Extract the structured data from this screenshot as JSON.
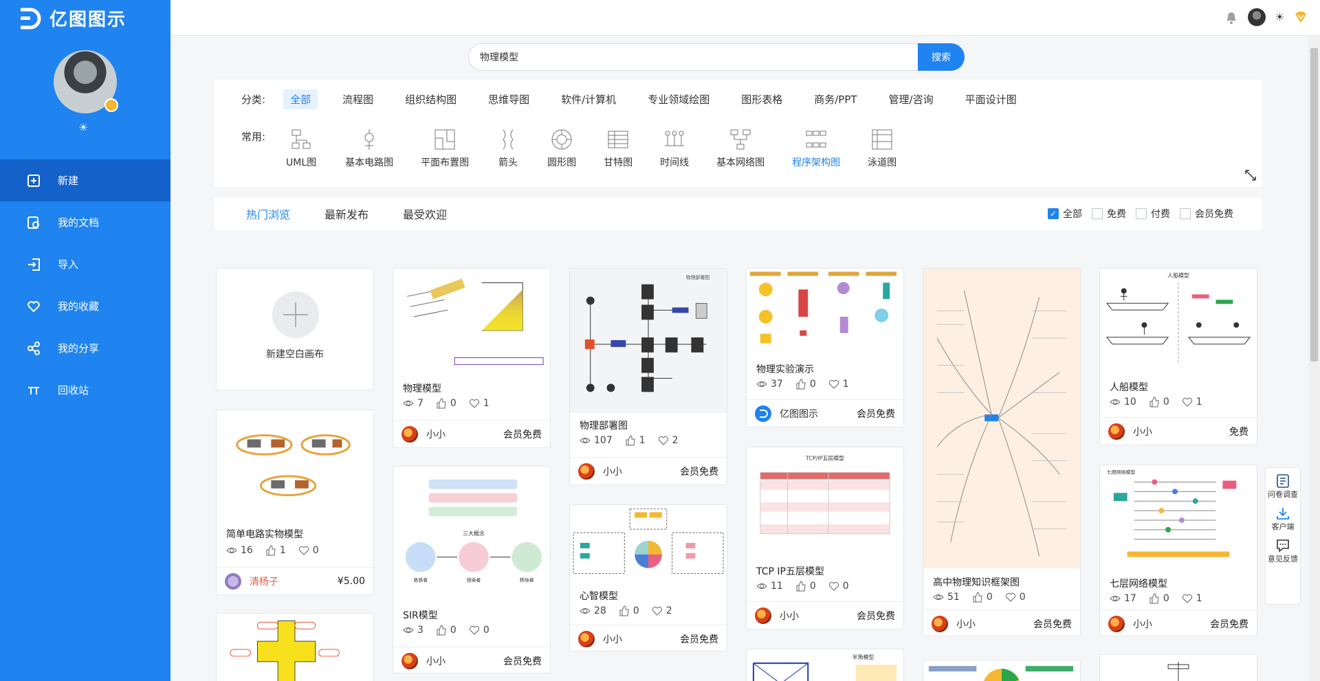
{
  "app": {
    "name": "亿图图示"
  },
  "sidebar": {
    "items": [
      {
        "label": "新建",
        "icon": "new-doc-icon"
      },
      {
        "label": "我的文档",
        "icon": "documents-icon"
      },
      {
        "label": "导入",
        "icon": "import-icon"
      },
      {
        "label": "我的收藏",
        "icon": "heart-icon"
      },
      {
        "label": "我的分享",
        "icon": "share-icon"
      },
      {
        "label": "回收站",
        "icon": "recycle-icon"
      }
    ]
  },
  "search": {
    "value": "物理模型",
    "button": "搜索"
  },
  "categories": {
    "label": "分类:",
    "items": [
      "全部",
      "流程图",
      "组织结构图",
      "思维导图",
      "软件/计算机",
      "专业领域绘图",
      "图形表格",
      "商务/PPT",
      "管理/咨询",
      "平面设计图"
    ]
  },
  "common": {
    "label": "常用:",
    "items": [
      "UML图",
      "基本电路图",
      "平面布置图",
      "箭头",
      "圆形图",
      "甘特图",
      "时间线",
      "基本网络图",
      "程序架构图",
      "泳道图"
    ]
  },
  "tabs": [
    "热门浏览",
    "最新发布",
    "最受欢迎"
  ],
  "filters": [
    "全部",
    "免费",
    "付费",
    "会员免费"
  ],
  "new_canvas": "新建空白画布",
  "cards": [
    {
      "title": "简单电路实物模型",
      "views": "16",
      "likes": "1",
      "favs": "0",
      "author": "清杨子",
      "price": "¥5.00"
    },
    {
      "title": "物理模型",
      "views": "7",
      "likes": "0",
      "favs": "1",
      "author": "小小",
      "price": "会员免费"
    },
    {
      "title": "SIR模型",
      "views": "3",
      "likes": "0",
      "favs": "0",
      "author": "小小",
      "price": "会员免费"
    },
    {
      "title": "物理部署图",
      "views": "107",
      "likes": "1",
      "favs": "2",
      "author": "小小",
      "price": "会员免费"
    },
    {
      "title": "心智模型",
      "views": "28",
      "likes": "0",
      "favs": "2",
      "author": "小小",
      "price": "会员免费"
    },
    {
      "title": "物理实验演示",
      "views": "37",
      "likes": "0",
      "favs": "1",
      "author": "亿图图示",
      "price": "会员免费"
    },
    {
      "title": "TCP IP五层模型",
      "views": "11",
      "likes": "0",
      "favs": "0",
      "author": "小小",
      "price": "会员免费"
    },
    {
      "title": "高中物理知识框架图",
      "views": "51",
      "likes": "0",
      "favs": "0",
      "author": "小小",
      "price": "会员免费"
    },
    {
      "title": "人船模型",
      "views": "10",
      "likes": "0",
      "favs": "1",
      "author": "小小",
      "price": "免费"
    },
    {
      "title": "七层网络模型",
      "views": "17",
      "likes": "0",
      "favs": "1",
      "author": "小小",
      "price": "会员免费"
    }
  ],
  "thumb_text": {
    "tcp_title": "TCP/IP五层模型",
    "sir_label": "三大概念",
    "sir_stage1": "易感者",
    "sir_stage2": "感染者",
    "sir_stage3": "移除者",
    "boat_title": "人船模型",
    "osi_title": "七层网络模型",
    "physics_title": "半角模型",
    "deploy_title": "物理部署图"
  },
  "float_panel": [
    "问卷调查",
    "客户端",
    "意见反馈"
  ],
  "colors": {
    "brand": "#1f83f0",
    "sidebar_active": "#1462c9",
    "accent_red": "#e9573f"
  }
}
